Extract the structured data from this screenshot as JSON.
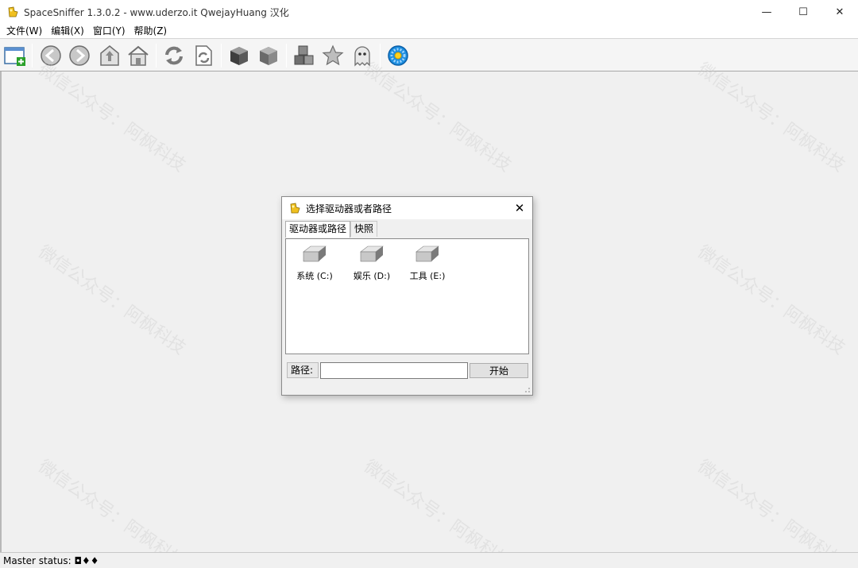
{
  "window": {
    "title": "SpaceSniffer 1.3.0.2 - www.uderzo.it  QwejayHuang 汉化",
    "minimize": "—",
    "maximize": "☐",
    "close": "✕"
  },
  "menu": [
    "文件(W)",
    "编辑(X)",
    "窗口(Y)",
    "帮助(Z)"
  ],
  "toolbar": {
    "icons": [
      "new-window-icon",
      "back-icon",
      "forward-icon",
      "up-icon",
      "home-icon",
      "refresh-icon",
      "refresh-page-icon",
      "zoom-in-box-icon",
      "zoom-out-box-icon",
      "cubes-icon",
      "star-icon",
      "ghost-icon",
      "settings-gear-icon"
    ]
  },
  "watermarks": [
    "微信公众号：阿枫科技"
  ],
  "status": {
    "text": "Master status: ◘♦♦"
  },
  "dialog": {
    "title": "选择驱动器或者路径",
    "close": "✕",
    "tabs": [
      "驱动器或路径",
      "快照"
    ],
    "drives": [
      {
        "label": "系统 (C:)"
      },
      {
        "label": "娱乐 (D:)"
      },
      {
        "label": "工具 (E:)"
      }
    ],
    "path_label": "路径:",
    "path_value": "",
    "start_button": "开始"
  },
  "colors": {
    "workspace": "#f0f0f0",
    "toolbar": "#f5f5f5",
    "accent_blue": "#1e8fe0"
  }
}
